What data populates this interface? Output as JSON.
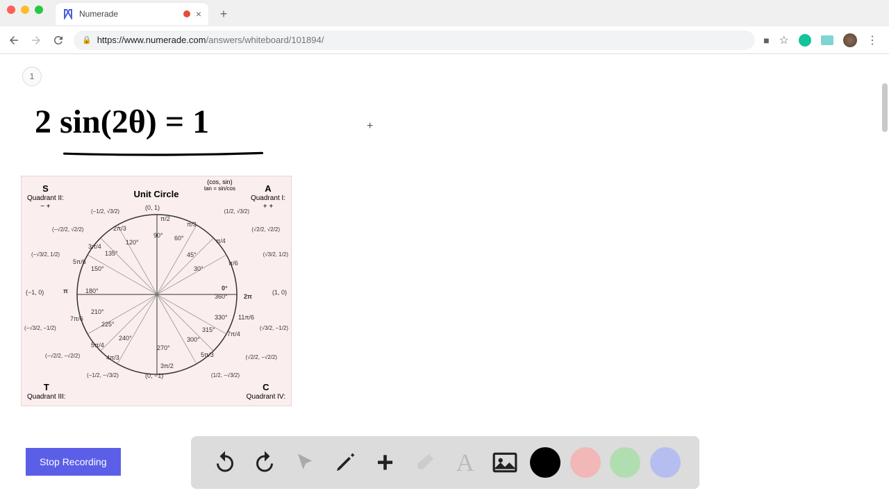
{
  "browser": {
    "tab_title": "Numerade",
    "url_host": "https://www.numerade.com",
    "url_path": "/answers/whiteboard/101894/",
    "close_glyph": "×",
    "new_tab_glyph": "+"
  },
  "whiteboard": {
    "page_number": "1",
    "equation": "2 sin(2θ) = 1",
    "cursor_glyph": "+"
  },
  "unit_circle": {
    "title": "Unit Circle",
    "cos_sin": "(cos, sin)",
    "tan_eq": "tan = sin/cos",
    "q1": {
      "letter": "A",
      "label": "Quadrant I:",
      "signs": "+ +"
    },
    "q2": {
      "letter": "S",
      "label": "Quadrant II:",
      "signs": "− +"
    },
    "q3": {
      "letter": "T",
      "label": "Quadrant III:",
      "signs": "− −"
    },
    "q4": {
      "letter": "C",
      "label": "Quadrant IV:",
      "signs": "+ −"
    },
    "top": "(0, 1)",
    "bottom": "(0, −1)",
    "left": "(−1, 0)",
    "right": "(1, 0)",
    "angles_deg": [
      "0°",
      "30°",
      "45°",
      "60°",
      "90°",
      "120°",
      "135°",
      "150°",
      "180°",
      "210°",
      "225°",
      "240°",
      "270°",
      "300°",
      "315°",
      "330°",
      "360°"
    ],
    "angles_rad": [
      "2π",
      "π/6",
      "π/4",
      "π/3",
      "π/2",
      "2π/3",
      "3π/4",
      "5π/6",
      "π",
      "7π/6",
      "5π/4",
      "4π/3",
      "3π/2",
      "5π/3",
      "7π/4",
      "11π/6"
    ],
    "coords": {
      "p30": "(√3/2, 1/2)",
      "p45": "(√2/2, √2/2)",
      "p60": "(1/2, √3/2)",
      "p120": "(−1/2, √3/2)",
      "p135": "(−√2/2, √2/2)",
      "p150": "(−√3/2, 1/2)",
      "p210": "(−√3/2, −1/2)",
      "p225": "(−√2/2, −√2/2)",
      "p240": "(−1/2, −√3/2)",
      "p300": "(1/2, −√3/2)",
      "p315": "(√2/2, −√2/2)",
      "p330": "(√3/2, −1/2)"
    }
  },
  "controls": {
    "stop_recording": "Stop Recording"
  },
  "colors": {
    "accent": "#5b5fe8",
    "black": "#000000",
    "pink": "#f2b8b8",
    "green": "#b0deb0",
    "blue": "#b6bef0"
  }
}
